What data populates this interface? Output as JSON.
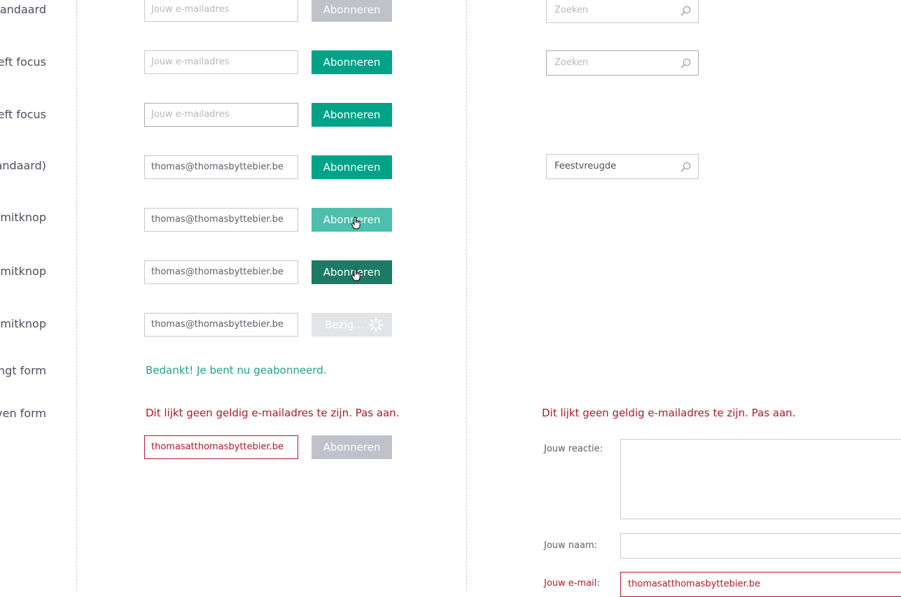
{
  "rows": [
    {
      "label": "Standaard"
    },
    {
      "label": "eeft focus"
    },
    {
      "label": "eeft focus"
    },
    {
      "label": "tandaard)"
    },
    {
      "label": "bmitknop"
    },
    {
      "label": "bmitknop"
    },
    {
      "label": "bmitknop"
    },
    {
      "label": "angt form"
    },
    {
      "label": "oven form"
    }
  ],
  "newsletter": {
    "email_placeholder": "Jouw e-mailadres",
    "email_value": "thomas@thomasbyttebier.be",
    "subscribe_label": "Abonneren",
    "busy_label": "Bezig...",
    "success_message": "Bedankt! Je bent nu geabonneerd.",
    "error_message": "Dit lijkt geen geldig e-mailadres te zijn. Pas aan.",
    "invalid_email_value": "thomasatthomasbyttebier.be"
  },
  "search": {
    "placeholder": "Zoeken",
    "filled_value": "Feestvreugde",
    "icon": "search-icon"
  },
  "comment_form": {
    "error_message": "Dit lijkt geen geldig e-mailadres te zijn. Pas aan.",
    "reaction_label": "Jouw reactie:",
    "name_label": "Jouw naam:",
    "email_label": "Jouw e-mail:",
    "email_value": "thomasatthomasbyttebier.be"
  },
  "colors": {
    "primary": "#00a388",
    "primary_hover": "#4dbfac",
    "primary_active": "#1e7a64",
    "disabled": "#c0c2c9",
    "success": "#1ea383",
    "error": "#b2172b"
  }
}
